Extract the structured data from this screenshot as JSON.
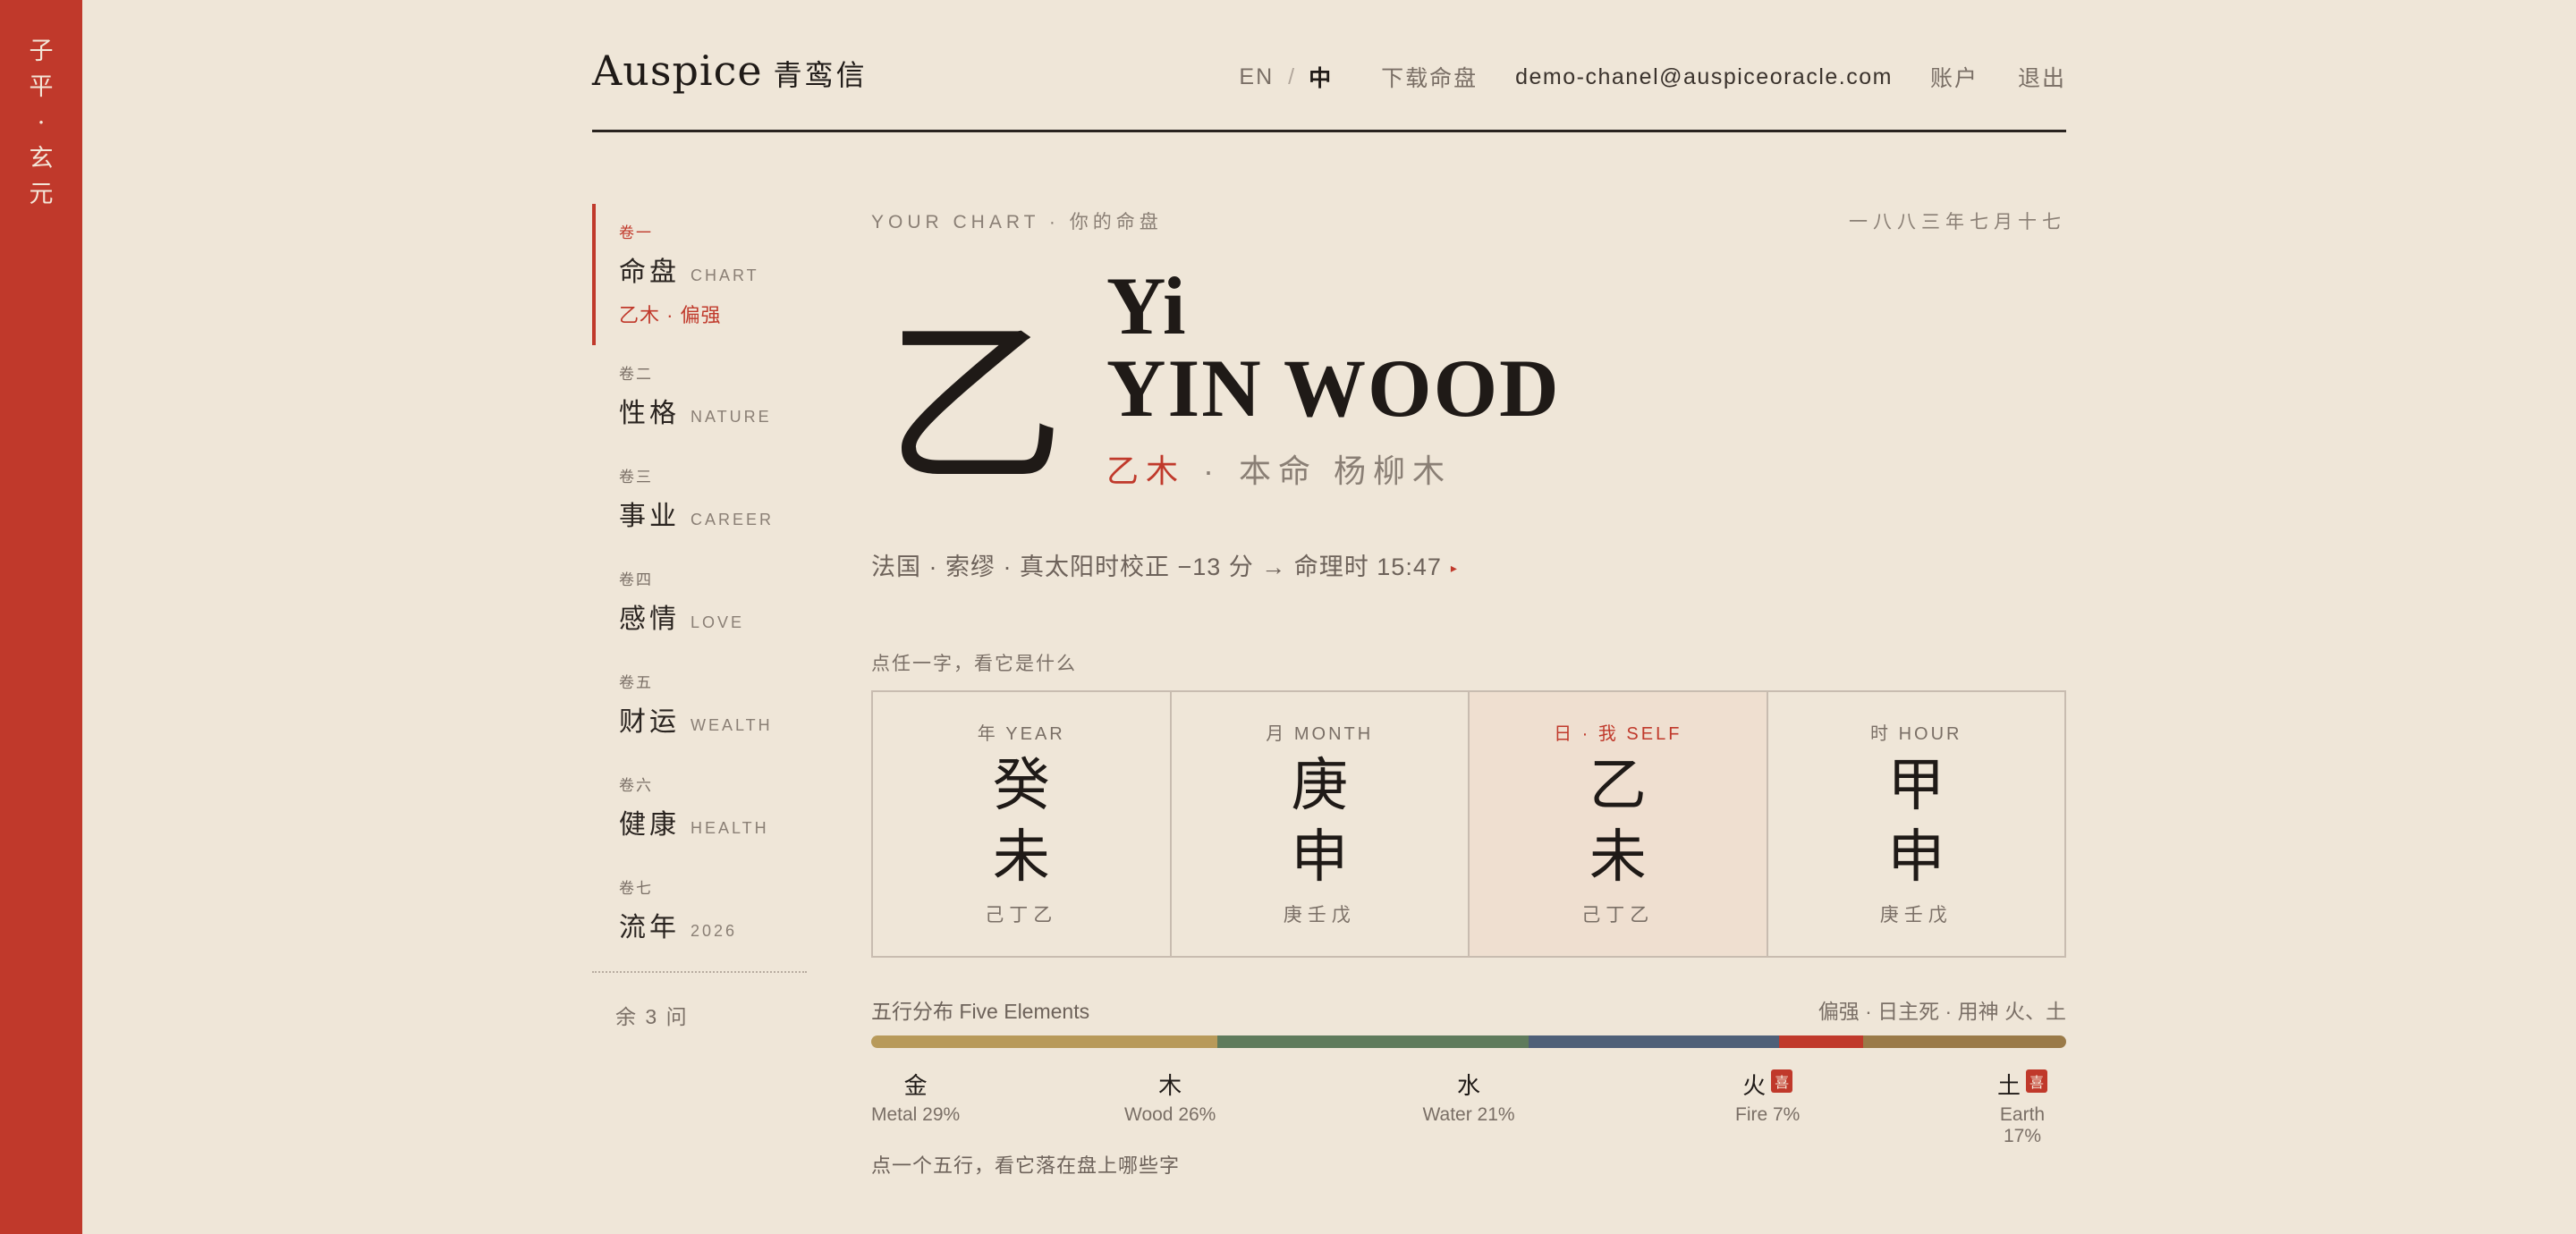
{
  "rail": {
    "chars": [
      "子",
      "平",
      "·",
      "玄",
      "元"
    ]
  },
  "header": {
    "logo": "Auspice",
    "logo_cn": "青鸾信",
    "lang_en": "EN",
    "lang_sep": "/",
    "lang_zh": "中",
    "download": "下载命盘",
    "email": "demo-chanel@auspiceoracle.com",
    "account": "账户",
    "logout": "退出"
  },
  "sidebar": {
    "items": [
      {
        "vol": "卷一",
        "cn": "命盘",
        "en": "CHART",
        "sub": "乙木 · 偏强"
      },
      {
        "vol": "卷二",
        "cn": "性格",
        "en": "NATURE"
      },
      {
        "vol": "卷三",
        "cn": "事业",
        "en": "CAREER"
      },
      {
        "vol": "卷四",
        "cn": "感情",
        "en": "LOVE"
      },
      {
        "vol": "卷五",
        "cn": "财运",
        "en": "WEALTH"
      },
      {
        "vol": "卷六",
        "cn": "健康",
        "en": "HEALTH"
      },
      {
        "vol": "卷七",
        "cn": "流年",
        "en": "2026"
      }
    ],
    "remaining": "余 3 问"
  },
  "main": {
    "kicker": "YOUR CHART · 你的命盘",
    "date": "一八八三年七月十七",
    "big_char": "乙",
    "title1": "Yi",
    "title2": "YIN WOOD",
    "sub_red": "乙木",
    "sub_dot": "·",
    "sub_rest": "本命 杨柳木",
    "location": "法国 · 索缪 · 真太阳时校正 −13 分 → 命理时 15:47",
    "location_marker": "▸"
  },
  "pillars": {
    "hint": "点任一字，看它是什么",
    "items": [
      {
        "label": "年 YEAR",
        "stem": "癸",
        "branch": "未",
        "hidden": "己丁乙",
        "self": false
      },
      {
        "label": "月 MONTH",
        "stem": "庚",
        "branch": "申",
        "hidden": "庚壬戊",
        "self": false
      },
      {
        "label": "日 · 我 SELF",
        "stem": "乙",
        "branch": "未",
        "hidden": "己丁乙",
        "self": true
      },
      {
        "label": "时 HOUR",
        "stem": "甲",
        "branch": "申",
        "hidden": "庚壬戊",
        "self": false
      }
    ]
  },
  "five_elements": {
    "title": "五行分布 Five Elements",
    "summary": "偏强 · 日主死 · 用神 火、土",
    "hint": "点一个五行，看它落在盘上哪些字",
    "badge": "喜",
    "items": [
      {
        "cn": "金",
        "en": "Metal 29%",
        "pct": 29,
        "color": "#b89a5a",
        "favored": false
      },
      {
        "cn": "木",
        "en": "Wood 26%",
        "pct": 26,
        "color": "#5f7b5c",
        "favored": false
      },
      {
        "cn": "水",
        "en": "Water 21%",
        "pct": 21,
        "color": "#4f6078",
        "favored": false
      },
      {
        "cn": "火",
        "en": "Fire 7%",
        "pct": 7,
        "color": "#c0392b",
        "favored": true
      },
      {
        "cn": "土",
        "en": "Earth 17%",
        "pct": 17,
        "color": "#9a7a48",
        "favored": true
      }
    ]
  }
}
